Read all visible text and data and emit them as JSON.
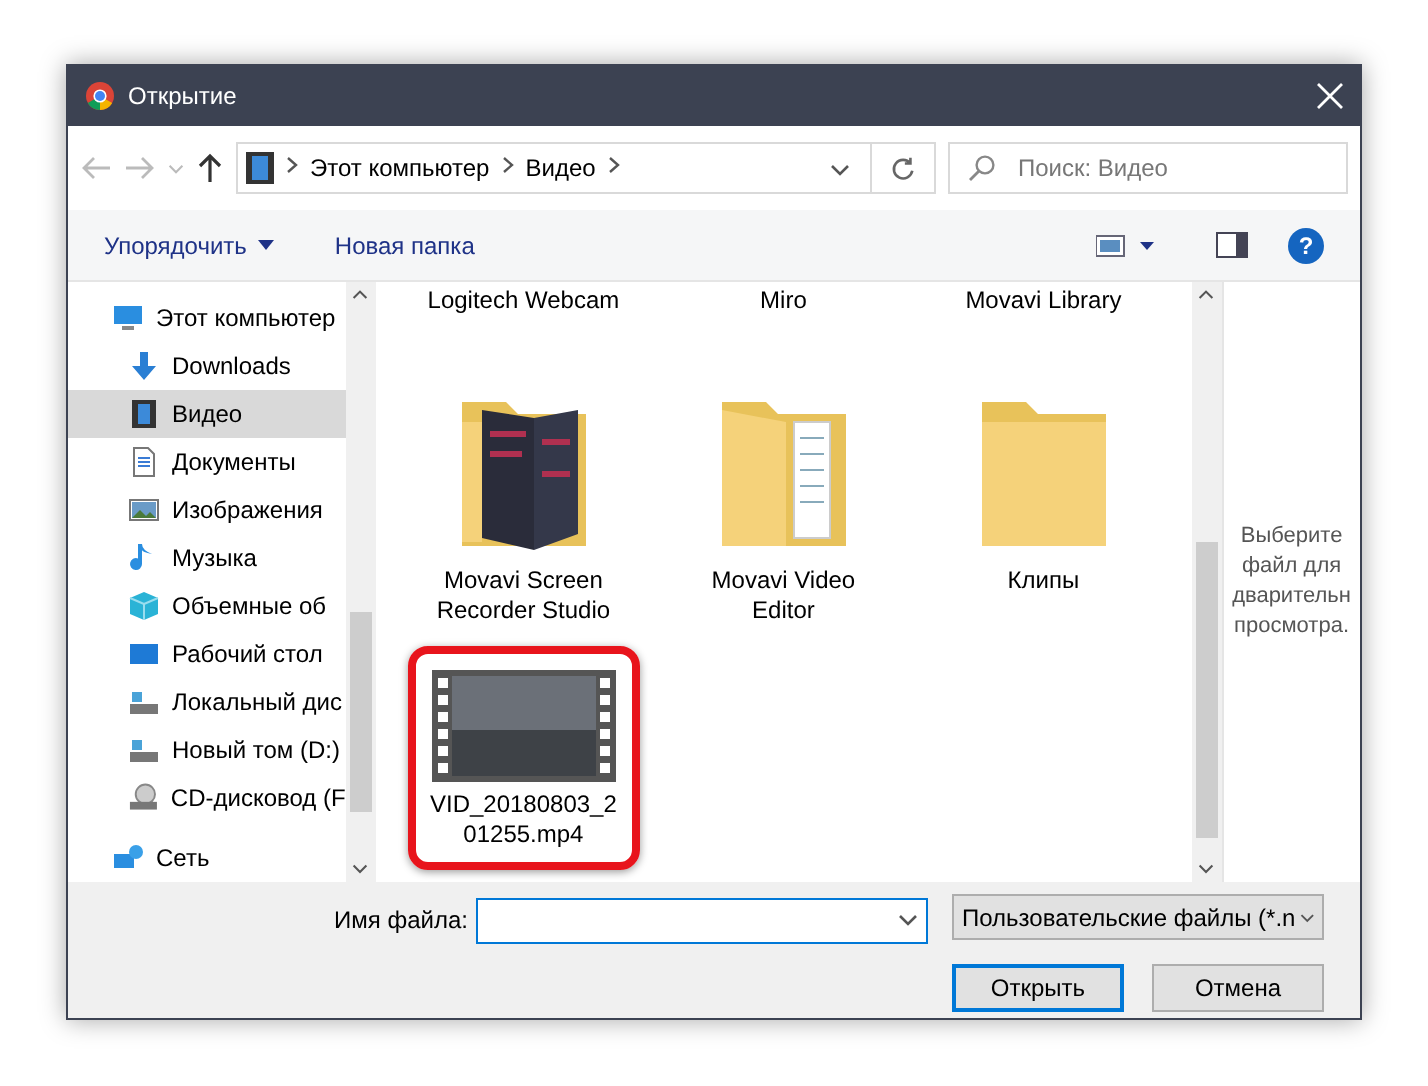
{
  "window": {
    "title": "Открытие"
  },
  "address": {
    "crumbs": [
      "Этот компьютер",
      "Видео"
    ]
  },
  "search": {
    "placeholder": "Поиск: Видео"
  },
  "toolbar": {
    "organize": "Упорядочить",
    "new_folder": "Новая папка",
    "help": "?"
  },
  "sidebar": {
    "items": [
      {
        "label": "Этот компьютер",
        "kind": "pc",
        "selected": false,
        "children": [
          {
            "label": "Downloads",
            "kind": "download",
            "selected": false
          },
          {
            "label": "Видео",
            "kind": "video",
            "selected": true
          },
          {
            "label": "Документы",
            "kind": "doc",
            "selected": false
          },
          {
            "label": "Изображения",
            "kind": "image",
            "selected": false
          },
          {
            "label": "Музыка",
            "kind": "music",
            "selected": false
          },
          {
            "label": "Объемные об",
            "kind": "cube",
            "selected": false
          },
          {
            "label": "Рабочий стол",
            "kind": "desktop",
            "selected": false
          },
          {
            "label": "Локальный дис",
            "kind": "drive",
            "selected": false
          },
          {
            "label": "Новый том (D:)",
            "kind": "drive",
            "selected": false
          },
          {
            "label": "CD-дисковод (F",
            "kind": "cd",
            "selected": false
          }
        ]
      },
      {
        "label": "Сеть",
        "kind": "network",
        "selected": false
      }
    ]
  },
  "files": [
    {
      "name": "Logitech Webcam",
      "kind": "cut"
    },
    {
      "name": "Miro",
      "kind": "cut"
    },
    {
      "name": "Movavi Library",
      "kind": "cut"
    },
    {
      "name": "Movavi Screen Recorder Studio",
      "kind": "folder-image"
    },
    {
      "name": "Movavi Video Editor",
      "kind": "folder-doc"
    },
    {
      "name": "Клипы",
      "kind": "folder"
    },
    {
      "name": "VID_20180803_201255.mp4",
      "kind": "video",
      "highlighted": true
    }
  ],
  "preview": {
    "text": "Выберите файл для дварительн просмотра."
  },
  "bottom": {
    "filename_label": "Имя файла:",
    "filter": "Пользовательские файлы (*.n",
    "open": "Открыть",
    "cancel": "Отмена"
  }
}
